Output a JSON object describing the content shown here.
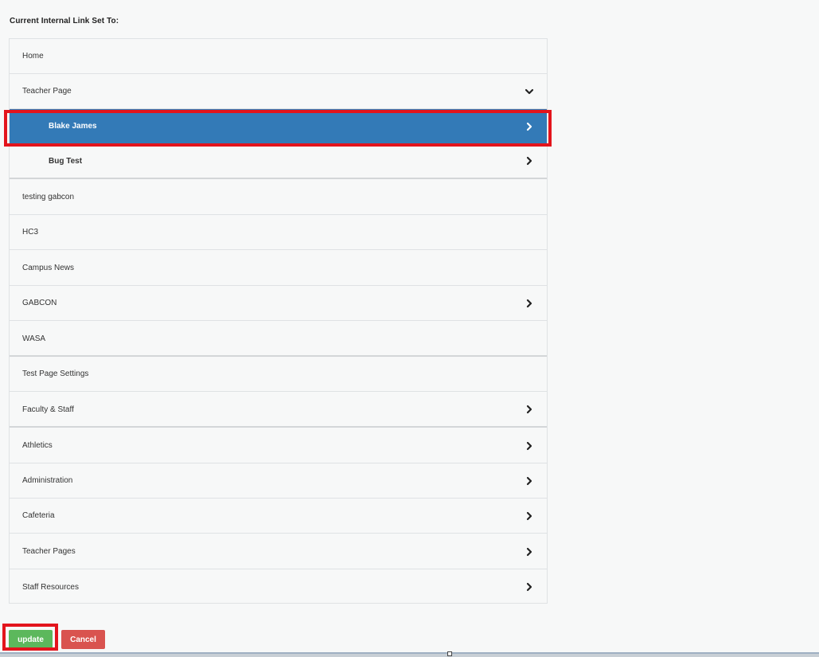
{
  "header": {
    "title": "Current Internal Link Set To:"
  },
  "tree": {
    "items": [
      {
        "label": "Home",
        "level": 0,
        "icon": "none"
      },
      {
        "label": "Teacher Page",
        "level": 0,
        "icon": "chevron-down-icon"
      },
      {
        "label": "Blake James",
        "level": 1,
        "icon": "chevron-right-icon",
        "selected": true
      },
      {
        "label": "Bug Test",
        "level": 1,
        "icon": "chevron-right-icon"
      },
      {
        "label": "testing gabcon",
        "level": 0,
        "icon": "none"
      },
      {
        "label": "HC3",
        "level": 0,
        "icon": "none"
      },
      {
        "label": "Campus News",
        "level": 0,
        "icon": "none"
      },
      {
        "label": "GABCON",
        "level": 0,
        "icon": "chevron-right-icon"
      },
      {
        "label": "WASA",
        "level": 0,
        "icon": "none"
      },
      {
        "label": "Test Page Settings",
        "level": 0,
        "icon": "none"
      },
      {
        "label": "Faculty & Staff",
        "level": 0,
        "icon": "chevron-right-icon"
      },
      {
        "label": "Athletics",
        "level": 0,
        "icon": "chevron-right-icon"
      },
      {
        "label": "Administration",
        "level": 0,
        "icon": "chevron-right-icon"
      },
      {
        "label": "Cafeteria",
        "level": 0,
        "icon": "chevron-right-icon"
      },
      {
        "label": "Teacher Pages",
        "level": 0,
        "icon": "chevron-right-icon"
      },
      {
        "label": "Staff Resources",
        "level": 0,
        "icon": "chevron-right-icon"
      }
    ]
  },
  "actions": {
    "update_label": "update",
    "cancel_label": "Cancel"
  },
  "colors": {
    "selected_bg": "#337ab7",
    "update_bg": "#5cb85c",
    "cancel_bg": "#d9534f",
    "highlight": "#e3141c"
  }
}
